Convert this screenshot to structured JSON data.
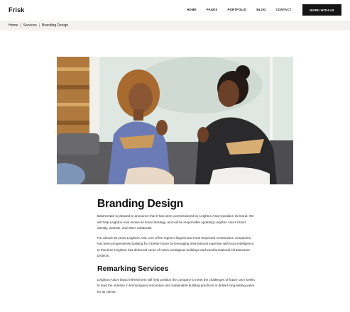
{
  "header": {
    "logo": "Frisk",
    "nav": [
      "HOME",
      "PAGES",
      "PORTFOLIO",
      "BLOG",
      "CONTACT"
    ],
    "cta_label": "WORK WITH US"
  },
  "breadcrumb": {
    "items": [
      "Home",
      "Services",
      "Branding Design"
    ]
  },
  "article": {
    "title": "Branding Design",
    "paragraphs": [
      "BaseCreate is pleased to announce that it has been commissioned by Leighton Asia reposition its brand. We will help Leighton Asia evolve its brand strategy, and will be responsible updating Leighton Asia's brand identity, website, and other collaterals.",
      "For almost 50 years Leighton Asia, one of the region's largest and most respected construction companies, has been progressively building for a better future by leveraging international expertise with local intelligence. In that time Leighton has delivered some of Asia's prestigious buildings and transformational infrastructure projects."
    ],
    "subtitle": "Remarking Services",
    "subparagraph": "Leighton Asia's brand refreshment will help position the company to meet the challenges of future, as it seeks to lead the industry in technological innovation and sustainable building practices to deliver long-lasting value for its clients."
  },
  "colors": {
    "cta_bg": "#151515",
    "crumb_bg": "#f3f2ef"
  }
}
